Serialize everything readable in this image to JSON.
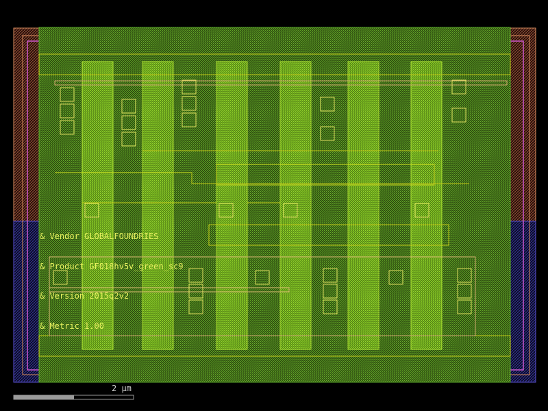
{
  "layout": {
    "annotations": [
      "& Vendor GLOBALFOUNDRIES",
      "& Product GF018hv5v_green_sc9",
      "& Version 2015q2v2",
      "& Metric 1.00"
    ]
  },
  "scale_bar": {
    "label": "2 µm"
  },
  "colors": {
    "background": "#000000",
    "nwell": "#d98c5f",
    "pwell": "#5a4fd1",
    "boundary": "#c957c9",
    "diffusion": "#7fd13b",
    "poly": "#c7d11a",
    "contact": "#e0e060",
    "metal": "#d4b070",
    "text": "#e8f060",
    "scale": "#9a9a9a",
    "scale_text": "#d0d0d0"
  }
}
